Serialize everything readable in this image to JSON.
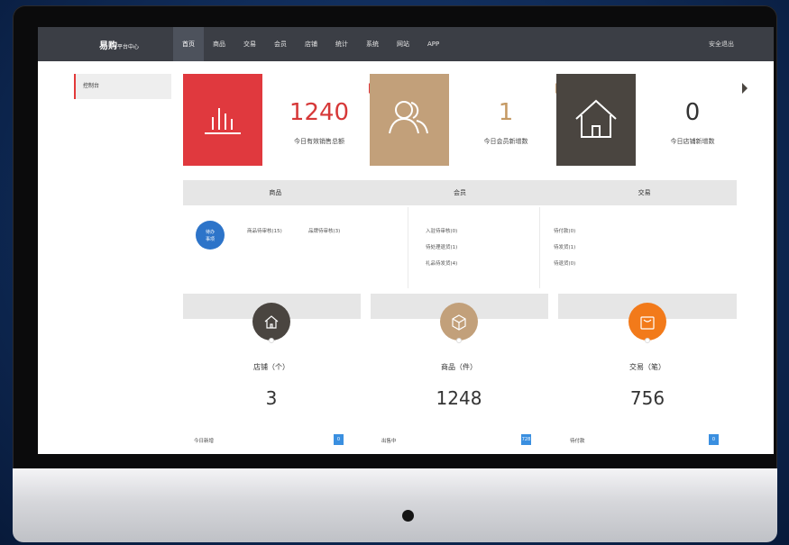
{
  "header": {
    "brand": "易购",
    "brand_sub": "平台中心",
    "nav": [
      "首页",
      "商品",
      "交易",
      "会员",
      "店铺",
      "统计",
      "系统",
      "网站",
      "APP"
    ],
    "logout": "安全退出"
  },
  "sidebar": {
    "items": [
      {
        "label": "控制台"
      }
    ]
  },
  "stats": [
    {
      "value": "1240",
      "label": "今日有效销售总额",
      "icon": "bar-chart-icon",
      "color": "#e0393e"
    },
    {
      "value": "1",
      "label": "今日会员新增数",
      "icon": "users-icon",
      "color": "#c2a07a"
    },
    {
      "value": "0",
      "label": "今日店铺新增数",
      "icon": "home-icon",
      "color": "#4a4540"
    }
  ],
  "sections": {
    "headers": [
      "商品",
      "会员",
      "交易"
    ]
  },
  "todo": {
    "badge": [
      "待办",
      "事项"
    ],
    "goods": [
      "商品待审核(15)",
      "品牌待审核(3)"
    ],
    "members": [
      "入驻待审核(0)",
      "待处理退货(1)",
      "礼品待发货(4)"
    ],
    "trade": [
      "待付款(0)",
      "待发货(1)",
      "待退货(0)"
    ]
  },
  "cards": [
    {
      "title": "店铺（个）",
      "value": "3",
      "icon": "home-icon",
      "color": "#4a4540",
      "row_label": "今日新增",
      "row_badge": "0"
    },
    {
      "title": "商品（件）",
      "value": "1248",
      "icon": "cube-icon",
      "color": "#c2a07a",
      "row_label": "出售中",
      "row_badge": "728"
    },
    {
      "title": "交易（笔）",
      "value": "756",
      "icon": "bag-icon",
      "color": "#f27a1a",
      "row_label": "待付款",
      "row_badge": "0"
    }
  ]
}
